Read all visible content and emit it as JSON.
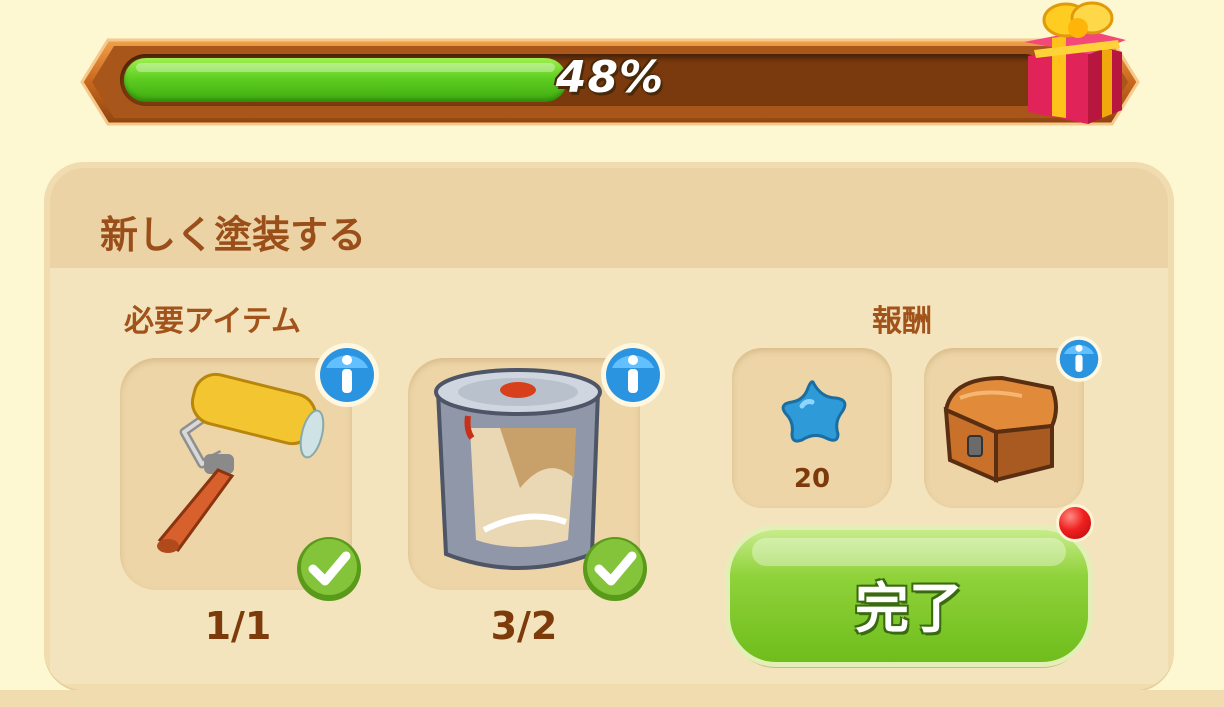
{
  "progress": {
    "value": 0.48,
    "label": "48%"
  },
  "panel": {
    "title": "新しく塗装する",
    "required_label": "必要アイテム",
    "reward_label": "報酬"
  },
  "required_items": [
    {
      "name": "paint-roller",
      "count": "1/1",
      "complete": true
    },
    {
      "name": "paint-bucket",
      "count": "3/2",
      "complete": true
    }
  ],
  "rewards": [
    {
      "name": "blue-star",
      "count": "20"
    },
    {
      "name": "treasure-chest",
      "count": ""
    }
  ],
  "complete_button": {
    "label": "完了"
  },
  "colors": {
    "accent_green": "#6fbd1c",
    "title_brown": "#9a4f1a",
    "count_brown": "#7d3b0c",
    "panel_bg": "#f6e7c0",
    "page_bg": "#fdf7d2"
  },
  "icons": [
    "gift-icon",
    "paint-roller-icon",
    "paint-bucket-icon",
    "blue-star-icon",
    "treasure-chest-icon",
    "info-icon",
    "check-icon"
  ]
}
